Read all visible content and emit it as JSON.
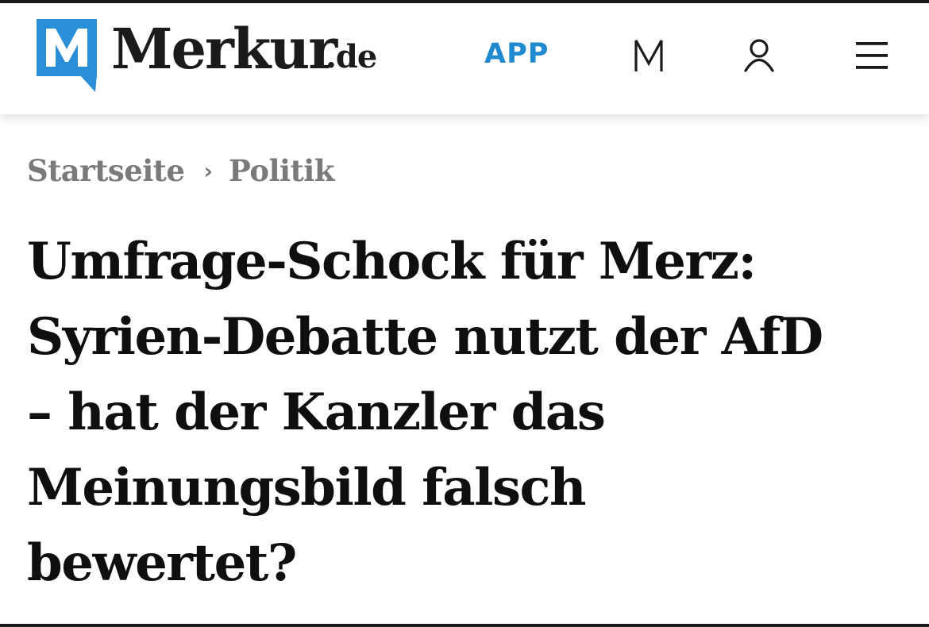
{
  "header": {
    "logo_text": "Merkur",
    "logo_tld": ".de",
    "app_label": "APP",
    "icons": [
      "merkur-m-icon",
      "user-icon",
      "menu-icon"
    ],
    "brand_color": "#1f8ad0"
  },
  "breadcrumb": {
    "items": [
      "Startseite",
      "Politik"
    ],
    "separator": "›"
  },
  "article": {
    "headline_lines": [
      "Umfrage-Schock für Merz:",
      "Syrien-Debatte nutzt der AfD",
      "– hat der Kanzler das",
      "Meinungsbild falsch",
      "bewertet?"
    ]
  }
}
